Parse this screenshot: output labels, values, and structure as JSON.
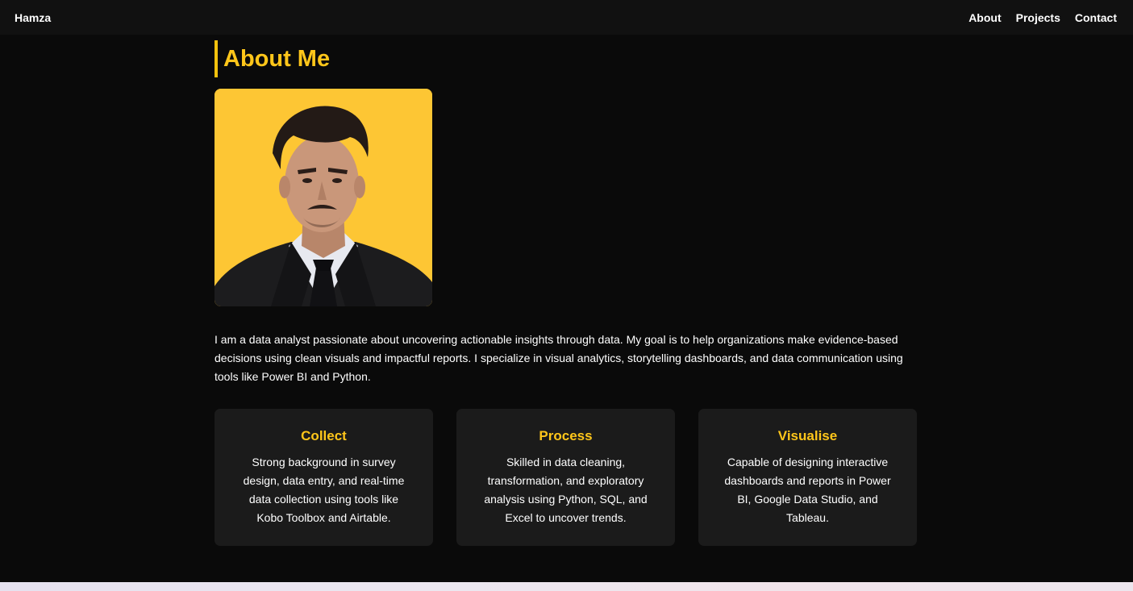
{
  "navbar": {
    "brand": "Hamza",
    "links": [
      "About",
      "Projects",
      "Contact"
    ]
  },
  "about": {
    "title": "About Me",
    "intro": "I am a data analyst passionate about uncovering actionable insights through data. My goal is to help organizations make evidence-based decisions using clean visuals and impactful reports. I specialize in visual analytics, storytelling dashboards, and data communication using tools like Power BI and Python.",
    "cards": [
      {
        "title": "Collect",
        "text": "Strong background in survey design, data entry, and real-time data collection using tools like Kobo Toolbox and Airtable."
      },
      {
        "title": "Process",
        "text": "Skilled in data cleaning, transformation, and exploratory analysis using Python, SQL, and Excel to uncover trends."
      },
      {
        "title": "Visualise",
        "text": "Capable of designing interactive dashboards and reports in Power BI, Google Data Studio, and Tableau."
      }
    ]
  },
  "colors": {
    "accent": "#ffc61a",
    "background": "#0a0a0a",
    "card": "#1b1b1b",
    "photo_background": "#fdc634"
  }
}
